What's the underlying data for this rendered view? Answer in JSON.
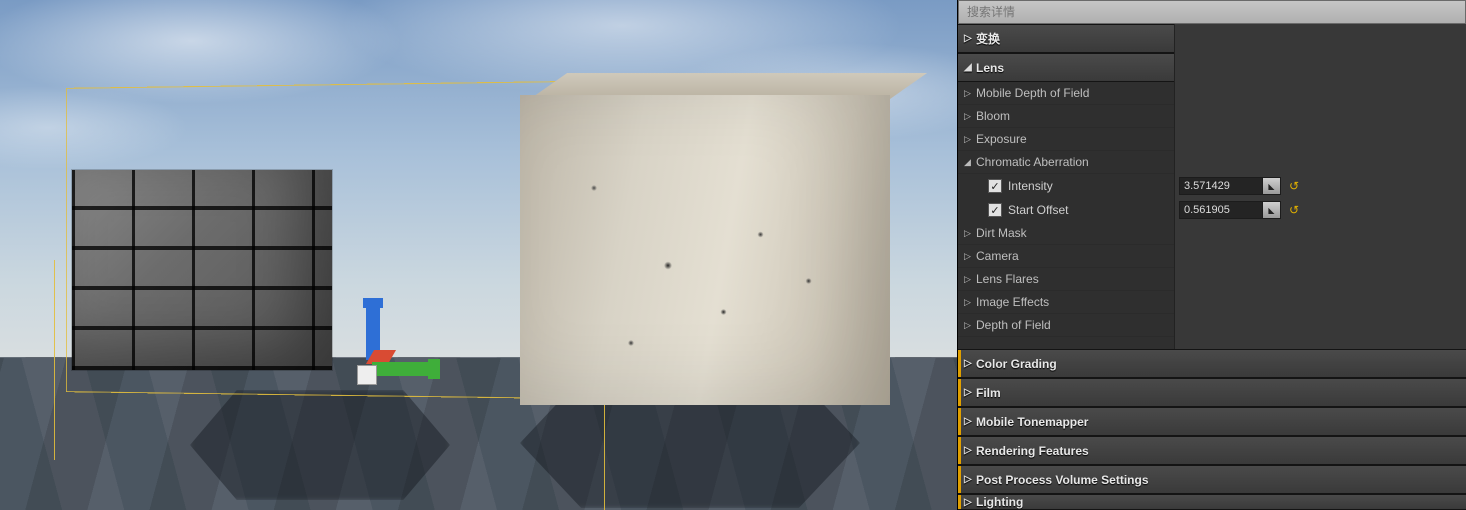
{
  "search": {
    "placeholder": "搜索详情"
  },
  "sections": {
    "transform": {
      "label": "变换",
      "expanded": false
    },
    "lens": {
      "label": "Lens",
      "expanded": true,
      "children": {
        "mobile_dof": {
          "label": "Mobile Depth of Field"
        },
        "bloom": {
          "label": "Bloom"
        },
        "exposure": {
          "label": "Exposure"
        },
        "chromatic": {
          "label": "Chromatic Aberration",
          "expanded": true,
          "props": {
            "intensity": {
              "label": "Intensity",
              "enabled": true,
              "value": "3.571429"
            },
            "start_offset": {
              "label": "Start Offset",
              "enabled": true,
              "value": "0.561905"
            }
          }
        },
        "dirt_mask": {
          "label": "Dirt Mask"
        },
        "camera": {
          "label": "Camera"
        },
        "lens_flares": {
          "label": "Lens Flares"
        },
        "image_effects": {
          "label": "Image Effects"
        },
        "depth_of_field": {
          "label": "Depth of Field"
        }
      }
    },
    "color_grading": {
      "label": "Color Grading"
    },
    "film": {
      "label": "Film"
    },
    "mobile_tonemapper": {
      "label": "Mobile Tonemapper"
    },
    "rendering_features": {
      "label": "Rendering Features"
    },
    "ppv_settings": {
      "label": "Post Process Volume Settings"
    },
    "lighting": {
      "label": "Lighting"
    }
  },
  "icons": {
    "check": "✓",
    "reset": "↺",
    "collapsed": "▷",
    "expanded": "◢",
    "spinner": "◣"
  }
}
